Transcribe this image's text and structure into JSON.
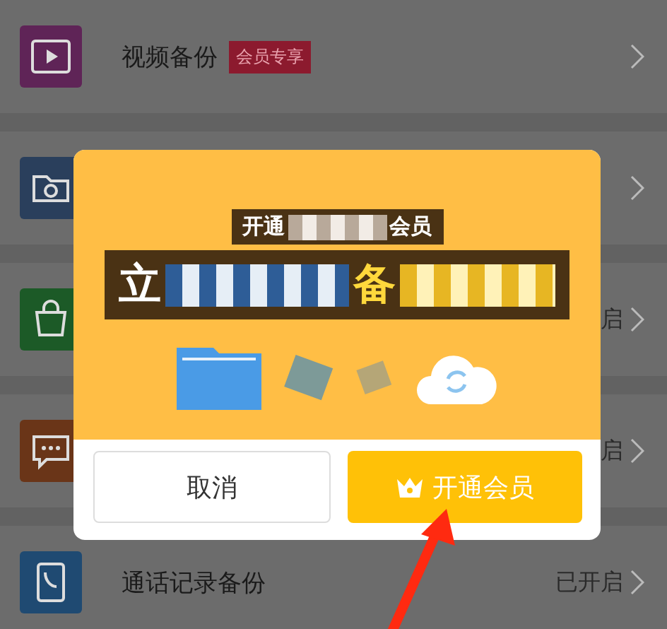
{
  "rows": [
    {
      "kind": "video",
      "title": "视频备份",
      "badge": "会员专享"
    },
    {
      "kind": "folder"
    },
    {
      "kind": "shop",
      "status": "启"
    },
    {
      "kind": "chat",
      "status": "启"
    },
    {
      "kind": "call",
      "title": "通话记录备份",
      "status": "已开启"
    }
  ],
  "dialog": {
    "headline_start": "开通",
    "headline_end": "会员",
    "banner_start": "立",
    "banner_end": "备",
    "cancel": "取消",
    "confirm": "开通会员"
  }
}
